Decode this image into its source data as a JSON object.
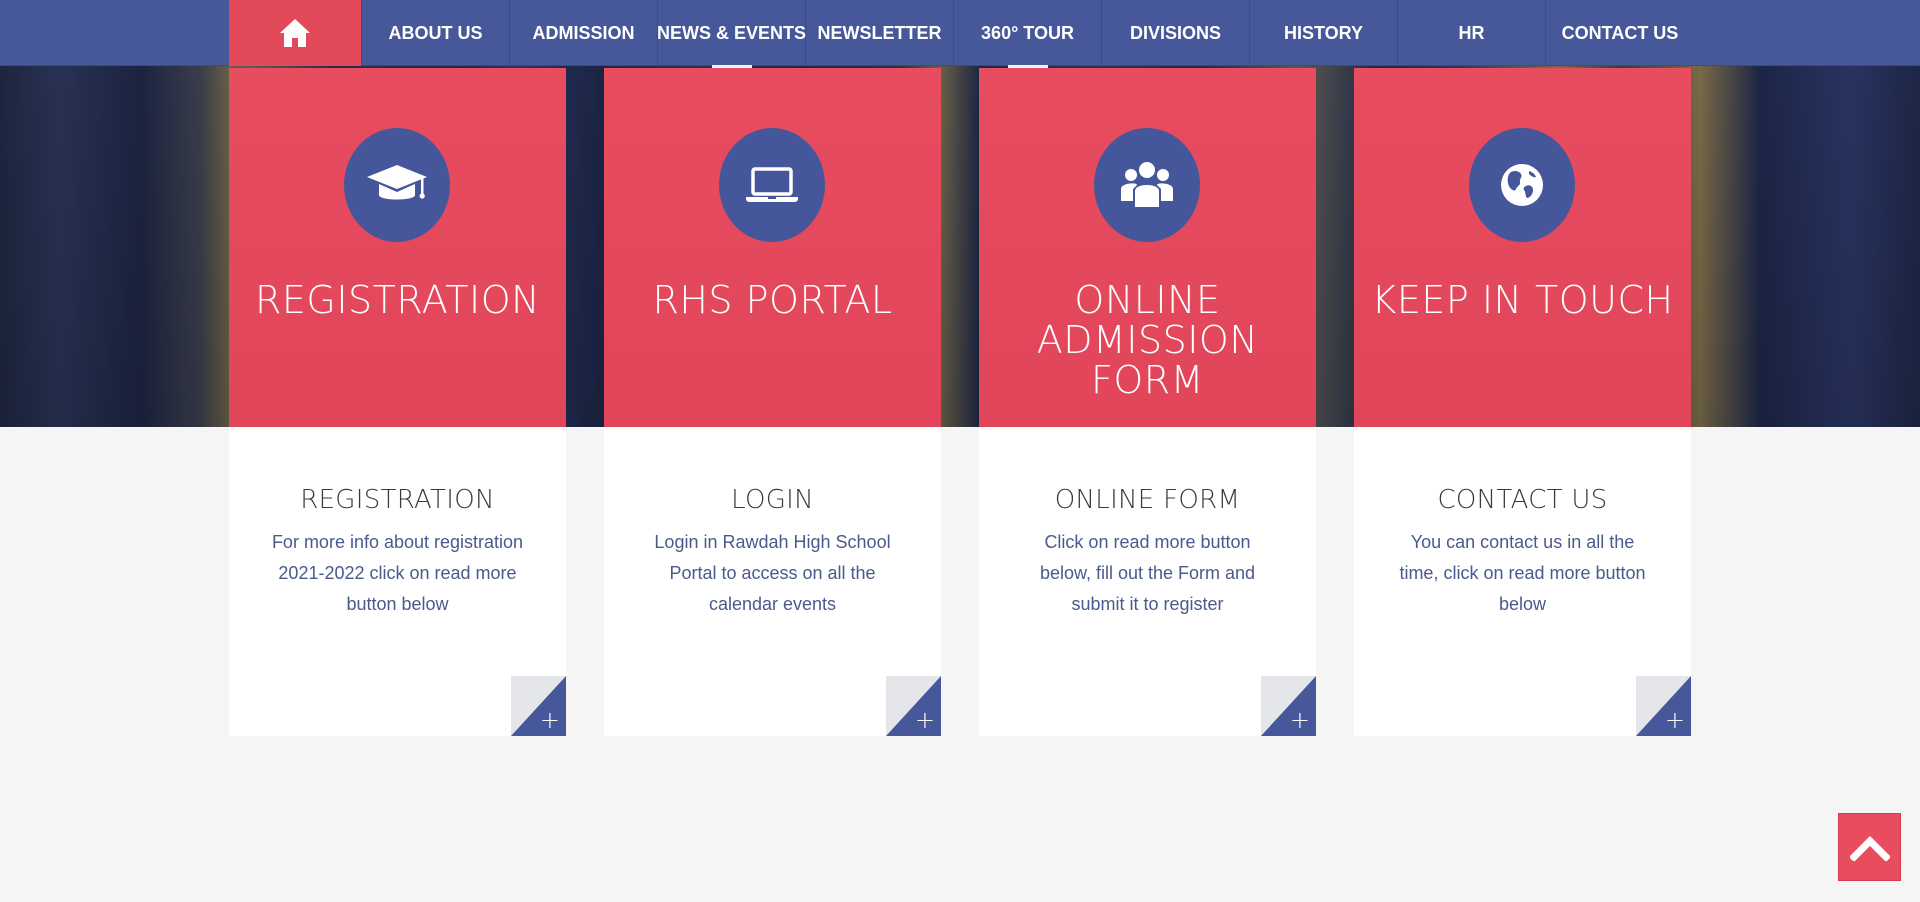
{
  "nav": {
    "home_icon": "home-icon",
    "items": [
      {
        "label": "ABOUT US"
      },
      {
        "label": "ADMISSION"
      },
      {
        "label": "NEWS & EVENTS"
      },
      {
        "label": "NEWSLETTER"
      },
      {
        "label": "360° TOUR"
      },
      {
        "label": "DIVISIONS"
      },
      {
        "label": "HISTORY"
      },
      {
        "label": "HR"
      },
      {
        "label": "CONTACT US"
      }
    ]
  },
  "cards": [
    {
      "icon": "graduation-cap-icon",
      "title": "REGISTRATION",
      "subtitle": "REGISTRATION",
      "description": "For more info about registration 2021-2022 click on read more button below",
      "more_label": "+"
    },
    {
      "icon": "laptop-icon",
      "title": "RHS PORTAL",
      "subtitle": "LOGIN",
      "description": "Login in Rawdah High School Portal to access on all the calendar events",
      "more_label": "+"
    },
    {
      "icon": "users-icon",
      "title": "ONLINE ADMISSION FORM",
      "subtitle": "ONLINE FORM",
      "description": "Click on read more button below, fill out the Form  and submit it to register",
      "more_label": "+"
    },
    {
      "icon": "globe-icon",
      "title": "KEEP IN TOUCH",
      "subtitle": "CONTACT US",
      "description": "You can contact us in all the time, click on read more button below",
      "more_label": "+"
    }
  ],
  "back_to_top_icon": "chevron-up-icon",
  "colors": {
    "nav": "#46589a",
    "accent": "#e74c5f",
    "page_bg": "#f5f5f6"
  }
}
